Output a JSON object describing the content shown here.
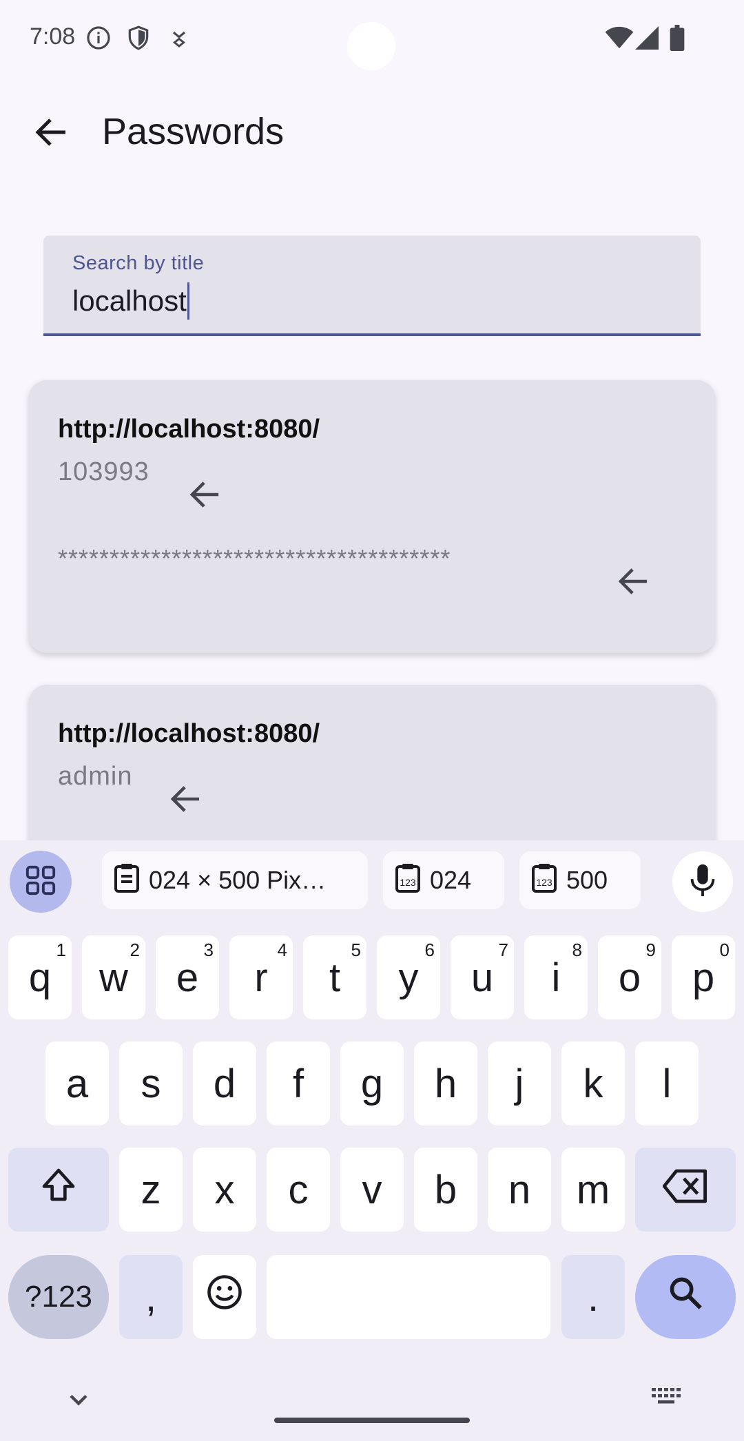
{
  "status_bar": {
    "time": "7:08"
  },
  "app_bar": {
    "title": "Passwords"
  },
  "search": {
    "label": "Search by title",
    "value": "localhost"
  },
  "entries": [
    {
      "title": "http://localhost:8080/",
      "username": "103993",
      "password": "**************************************"
    },
    {
      "title": "http://localhost:8080/",
      "username": "admin"
    }
  ],
  "keyboard": {
    "suggestions": [
      {
        "label": "024 × 500 Pix…",
        "icon": "clipboard-icon"
      },
      {
        "label": "024",
        "icon": "clipboard-number-icon"
      },
      {
        "label": "500",
        "icon": "clipboard-number-icon"
      }
    ],
    "row1": [
      {
        "key": "q",
        "hint": "1"
      },
      {
        "key": "w",
        "hint": "2"
      },
      {
        "key": "e",
        "hint": "3"
      },
      {
        "key": "r",
        "hint": "4"
      },
      {
        "key": "t",
        "hint": "5"
      },
      {
        "key": "y",
        "hint": "6"
      },
      {
        "key": "u",
        "hint": "7"
      },
      {
        "key": "i",
        "hint": "8"
      },
      {
        "key": "o",
        "hint": "9"
      },
      {
        "key": "p",
        "hint": "0"
      }
    ],
    "row2": [
      "a",
      "s",
      "d",
      "f",
      "g",
      "h",
      "j",
      "k",
      "l"
    ],
    "row3": [
      "z",
      "x",
      "c",
      "v",
      "b",
      "n",
      "m"
    ],
    "symbols_label": "?123",
    "comma_label": ",",
    "period_label": "."
  },
  "colors": {
    "accent": "#4f5590",
    "background": "#f9f7fd",
    "card": "#e3e1ea",
    "keyboard": "#f0edf6"
  }
}
